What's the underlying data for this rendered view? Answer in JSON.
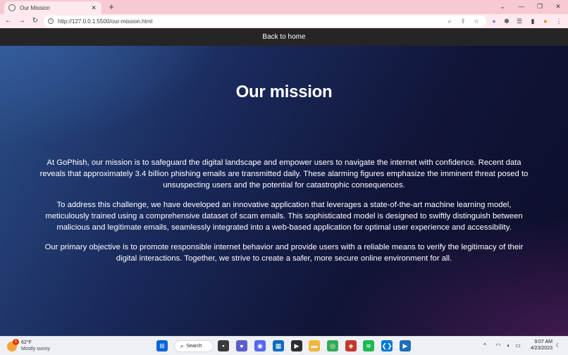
{
  "browser": {
    "tab_title": "Our Mission",
    "tab_close": "✕",
    "new_tab": "+",
    "url": "http://127.0.0.1:5500/our-mission.html",
    "window_controls": {
      "list": "⌄",
      "minimize": "—",
      "restore": "❐",
      "close": "✕"
    },
    "nav": {
      "back": "←",
      "forward": "→",
      "reload": "↻"
    },
    "icons": {
      "info": "i",
      "zoom": "⌕",
      "share": "⇪",
      "bookmark": "☆",
      "extension": "✽",
      "reading_list": "☰",
      "side_panel": "▮",
      "profile": "●",
      "menu": "⋮"
    }
  },
  "page": {
    "nav_link": "Back to home",
    "title": "Our mission",
    "paragraphs": [
      "At GoPhish, our mission is to safeguard the digital landscape and empower users to navigate the internet with confidence. Recent data reveals that approximately 3.4 billion phishing emails are transmitted daily. These alarming figures emphasize the imminent threat posed to unsuspecting users and the potential for catastrophic consequences.",
      "To address this challenge, we have developed an innovative application that leverages a state-of-the-art machine learning model, meticulously trained using a comprehensive dataset of scam emails. This sophisticated model is designed to swiftly distinguish between malicious and legitimate emails, seamlessly integrated into a web-based application for optimal user experience and accessibility.",
      "Our primary objective is to promote responsible internet behavior and provide users with a reliable means to verify the legitimacy of their digital interactions. Together, we strive to create a safer, more secure online environment for all."
    ]
  },
  "taskbar": {
    "weather": {
      "temp": "62°F",
      "desc": "Mostly sunny",
      "badge": "1"
    },
    "search_label": "Search",
    "search_glyph": "⌕",
    "apps": [
      {
        "name": "start-icon",
        "glyph": "⊞",
        "color": "#0a66d8"
      },
      {
        "name": "file-explorer-taskview-icon",
        "glyph": "▪",
        "color": "#3a3a3a"
      },
      {
        "name": "chat-icon",
        "glyph": "●",
        "color": "#5b5fc7"
      },
      {
        "name": "discord-icon",
        "glyph": "◉",
        "color": "#5865f2"
      },
      {
        "name": "calculator-icon",
        "glyph": "▦",
        "color": "#0f6cbd"
      },
      {
        "name": "terminal-icon",
        "glyph": "▶",
        "color": "#2d2d2d"
      },
      {
        "name": "folder-icon",
        "glyph": "▬",
        "color": "#f4b63a"
      },
      {
        "name": "chrome-icon",
        "glyph": "◎",
        "color": "#34a853"
      },
      {
        "name": "app-icon",
        "glyph": "◈",
        "color": "#c0392b"
      },
      {
        "name": "spotify-icon",
        "glyph": "≋",
        "color": "#1db954"
      },
      {
        "name": "vscode-icon",
        "glyph": "❮❯",
        "color": "#0078d4"
      },
      {
        "name": "media-icon",
        "glyph": "▶",
        "color": "#1e6fb8"
      }
    ],
    "tray": {
      "chevron": "^",
      "wifi": "◠",
      "volume": "◖",
      "battery": "▭",
      "notification": "☾"
    },
    "time": "9:07 AM",
    "date": "4/23/2023"
  },
  "colors": {
    "tabbar": "#f6c9d3",
    "toolbar": "#fde9ee",
    "page_nav": "#252526",
    "text": "#ffffff"
  }
}
